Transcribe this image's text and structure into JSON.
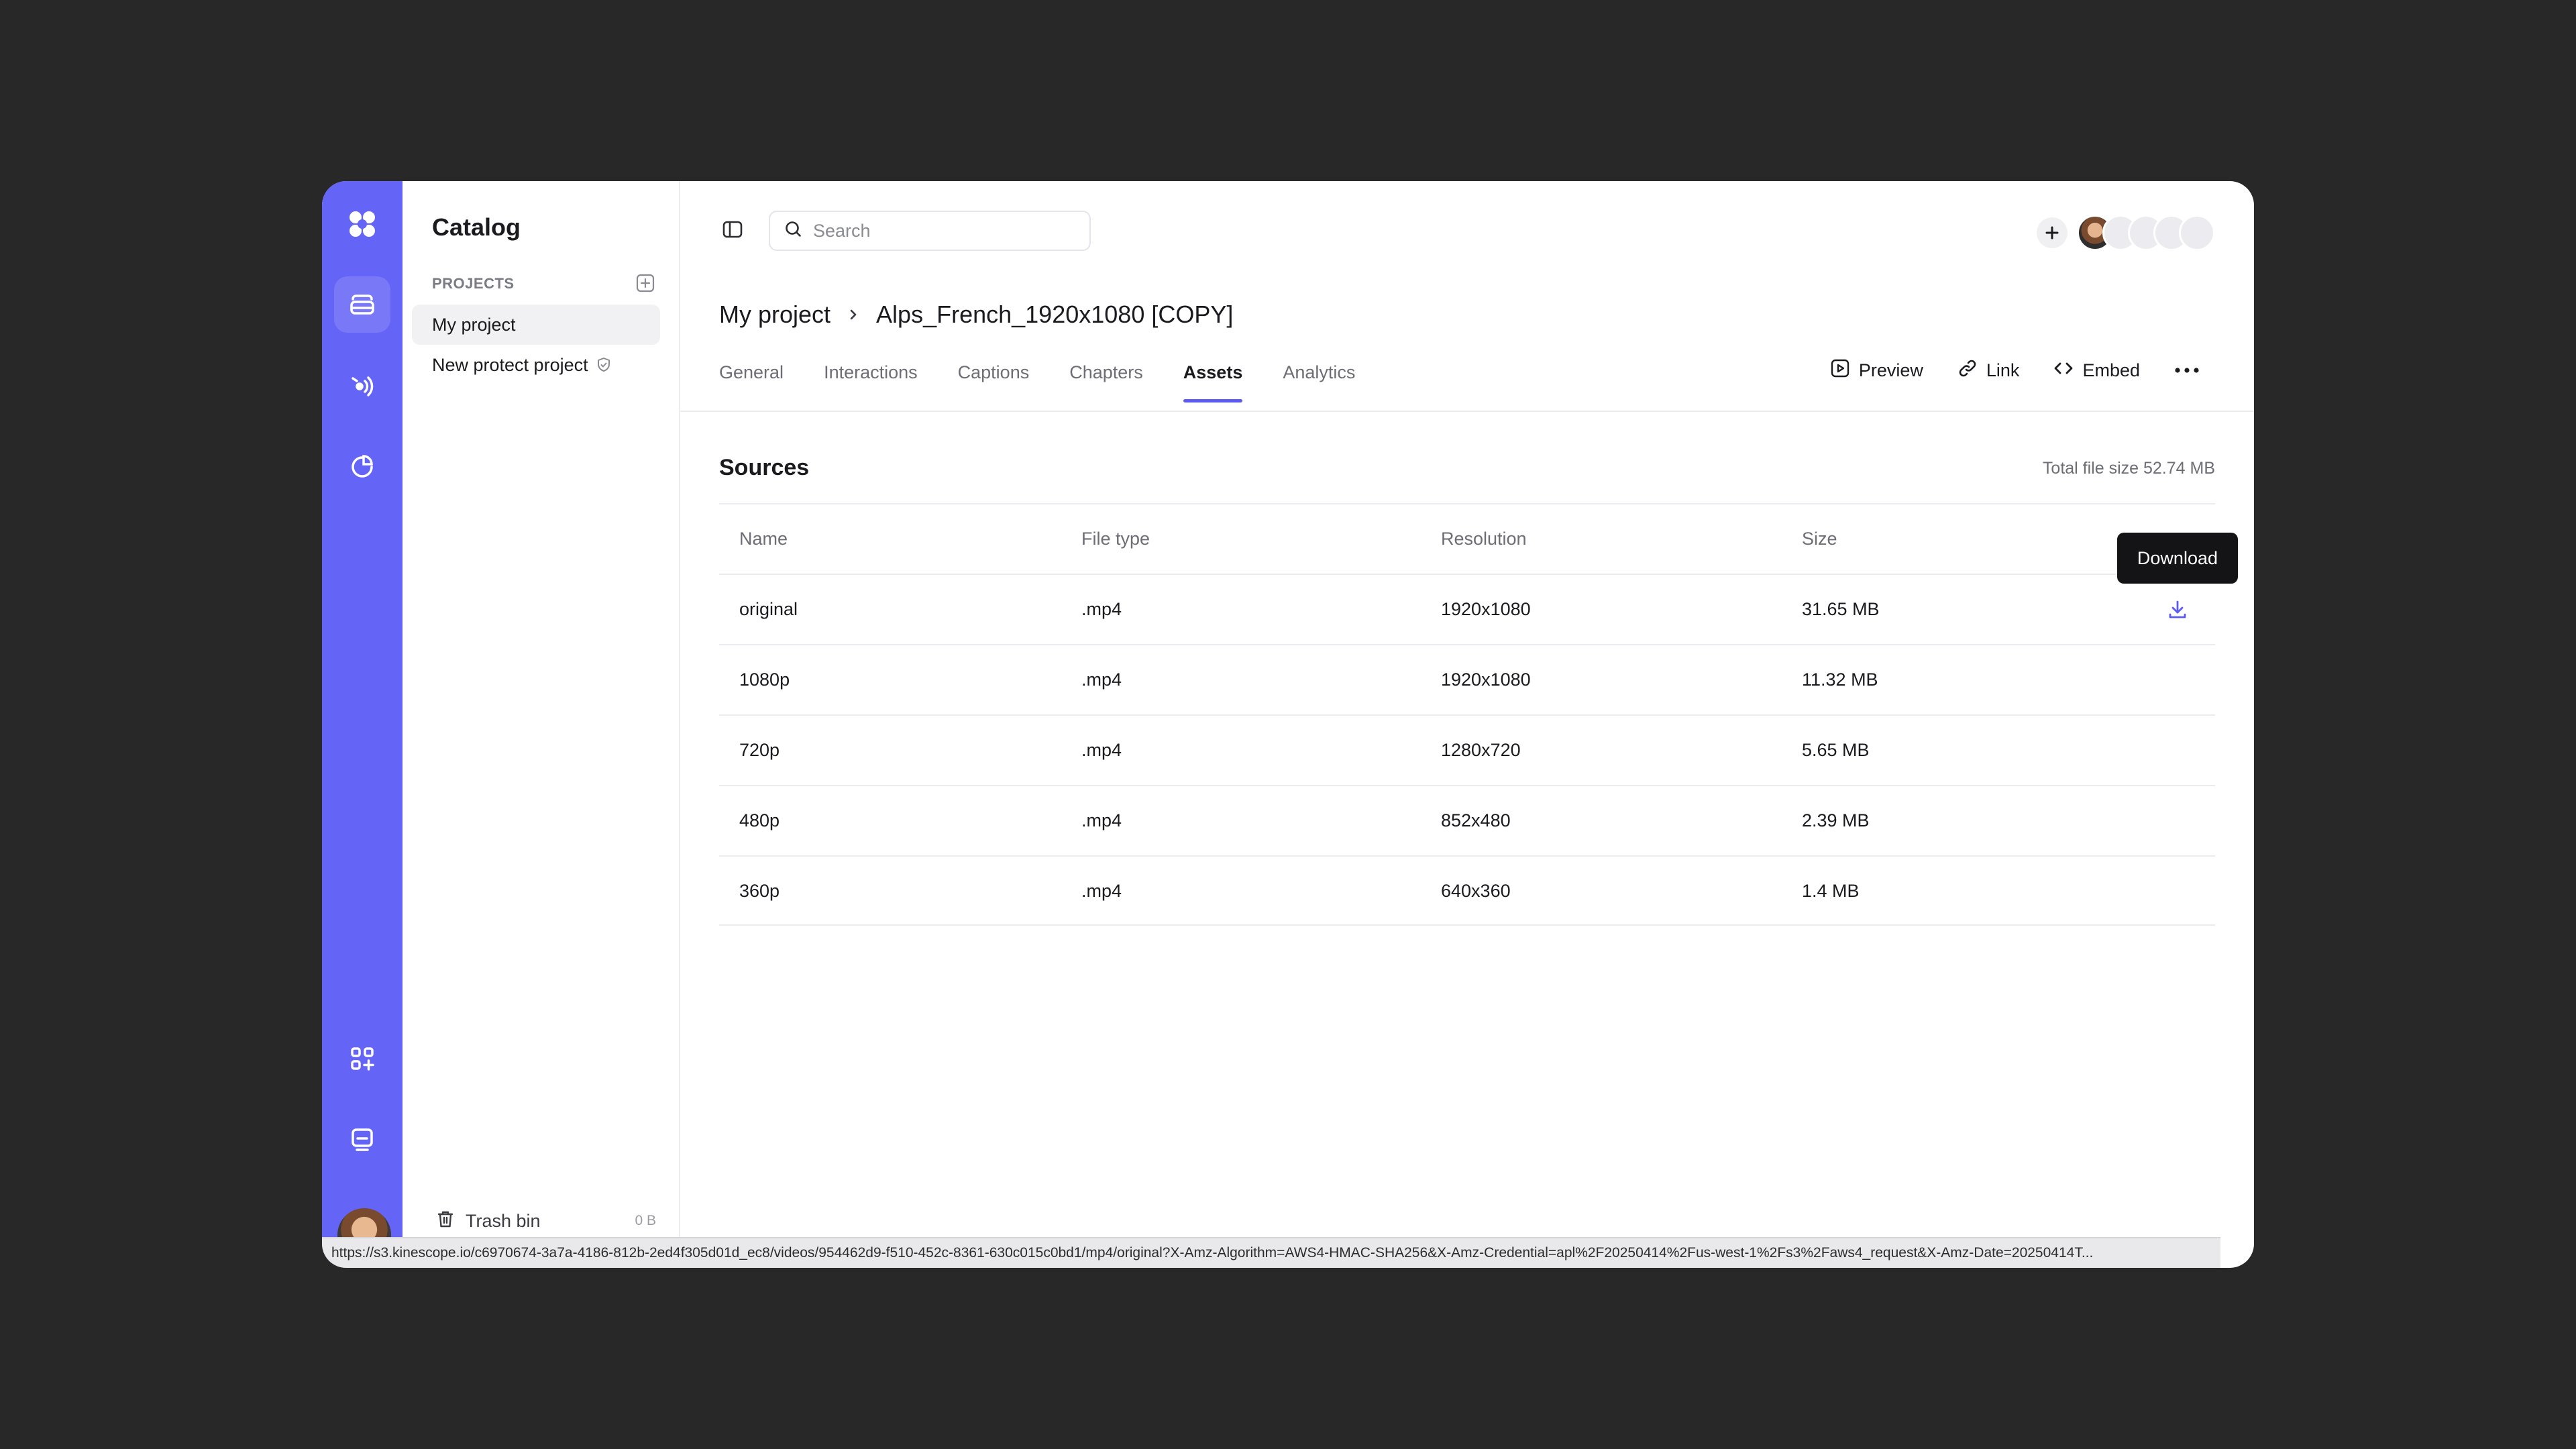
{
  "sidebar": {
    "title": "Catalog",
    "projects_label": "PROJECTS",
    "projects": [
      {
        "label": "My project",
        "active": true
      },
      {
        "label": "New protect project",
        "protected": true
      }
    ],
    "trash": {
      "label": "Trash bin",
      "size": "0 B"
    }
  },
  "rail": {
    "icons": [
      "logo-icon",
      "catalog-icon",
      "live-stream-icon",
      "analytics-icon",
      "apps-icon",
      "chat-icon"
    ],
    "accent": "#6464f6"
  },
  "header": {
    "search_placeholder": "Search"
  },
  "breadcrumb": {
    "project": "My project",
    "video": "Alps_French_1920x1080 [COPY]"
  },
  "tabs": [
    {
      "label": "General"
    },
    {
      "label": "Interactions"
    },
    {
      "label": "Captions"
    },
    {
      "label": "Chapters"
    },
    {
      "label": "Assets",
      "active": true
    },
    {
      "label": "Analytics"
    }
  ],
  "actions": {
    "preview": "Preview",
    "link": "Link",
    "embed": "Embed"
  },
  "sources": {
    "title": "Sources",
    "total": "Total file size 52.74 MB",
    "columns": {
      "name": "Name",
      "type": "File type",
      "resolution": "Resolution",
      "size": "Size"
    },
    "rows": [
      {
        "name": "original",
        "type": ".mp4",
        "resolution": "1920x1080",
        "size": "31.65 MB"
      },
      {
        "name": "1080p",
        "type": ".mp4",
        "resolution": "1920x1080",
        "size": "11.32 MB"
      },
      {
        "name": "720p",
        "type": ".mp4",
        "resolution": "1280x720",
        "size": "5.65 MB"
      },
      {
        "name": "480p",
        "type": ".mp4",
        "resolution": "852x480",
        "size": "2.39 MB"
      },
      {
        "name": "360p",
        "type": ".mp4",
        "resolution": "640x360",
        "size": "1.4 MB"
      }
    ],
    "tooltip": "Download"
  },
  "statusbar": {
    "url": "https://s3.kinescope.io/c6970674-3a7a-4186-812b-2ed4f305d01d_ec8/videos/954462d9-f510-452c-8361-630c015c0bd1/mp4/original?X-Amz-Algorithm=AWS4-HMAC-SHA256&X-Amz-Credential=apl%2F20250414%2Fus-west-1%2Fs3%2Faws4_request&X-Amz-Date=20250414T..."
  }
}
